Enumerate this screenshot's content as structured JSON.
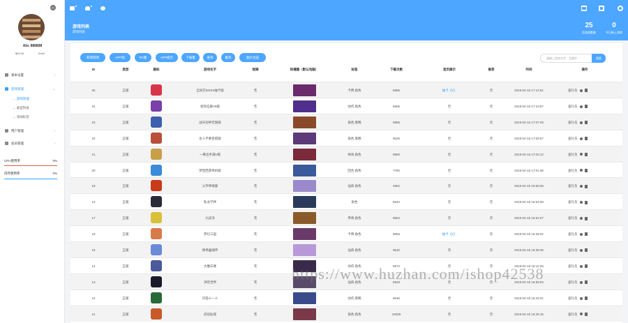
{
  "user": {
    "name": "Abc 888888",
    "balance_a": "$00.00",
    "balance_b": "Exx0"
  },
  "sidebar": {
    "items": [
      {
        "label": "基本设置"
      },
      {
        "label": "游戏管理"
      },
      {
        "label": "用户管理"
      },
      {
        "label": "会员管理"
      }
    ],
    "subitems": [
      {
        "label": "→ 游戏管理"
      },
      {
        "label": "→ 类型列表"
      },
      {
        "label": "→ 添加标签"
      }
    ],
    "stats": [
      {
        "label": "CPU使用率",
        "value": "0%"
      },
      {
        "label": "内存使用率",
        "value": "0%"
      }
    ]
  },
  "banner": {
    "title": "游戏列表",
    "subtitle": "游戏列表",
    "counters": [
      {
        "value": "25",
        "label": "总游戏数量"
      },
      {
        "value": "0",
        "label": "今日新上游戏"
      }
    ]
  },
  "toolbar": {
    "buttons": [
      "新增游戏",
      "APP图",
      "PC图",
      "APP提示",
      "下载量",
      "查询",
      "推荐",
      "图片合成"
    ],
    "search_placeholder": "请输入游戏名字、关键字",
    "search_label": "搜索"
  },
  "table": {
    "columns": [
      "ID",
      "类型",
      "图标",
      "游戏名字",
      "视频",
      "轮播图（默认电脑）",
      "标签",
      "下载次数",
      "首页展示",
      "推荐",
      "时间",
      "操作"
    ],
    "rows": [
      {
        "id": "25",
        "type": "正版",
        "name": "全民打BOSS抽卡版",
        "video": "无",
        "tags": "卡牌,角色",
        "downloads": "6895",
        "home": "抽卡【1】",
        "rec": "否",
        "time": "2019-02-15 17:14:01",
        "color": "#d8344a",
        "thumb": "#6a2a6c"
      },
      {
        "id": "24",
        "type": "正版",
        "name": "星际征服V8版",
        "video": "无",
        "tags": "动作,角色",
        "downloads": "6956",
        "home": "否",
        "rec": "否",
        "time": "2019-02-15 17:10:57",
        "color": "#7a3fa8",
        "thumb": "#502e8c"
      },
      {
        "id": "23",
        "type": "正版",
        "name": "战天封神无限版",
        "video": "无",
        "tags": "角色,策略",
        "downloads": "9856",
        "home": "否",
        "rec": "否",
        "time": "2019-02-15 17:07:49",
        "color": "#3d5fae",
        "thumb": "#8a4a2a"
      },
      {
        "id": "22",
        "type": "正版",
        "name": "女人不要百搭版",
        "video": "无",
        "tags": "角色,策略",
        "downloads": "9625",
        "home": "否",
        "rec": "否",
        "time": "2019-02-15 17:05:57",
        "color": "#b8503a",
        "thumb": "#5c3a7a"
      },
      {
        "id": "21",
        "type": "正版",
        "name": "一拳出手满V版",
        "video": "无",
        "tags": "休闲,角色",
        "downloads": "9850",
        "home": "否",
        "rec": "否",
        "time": "2019-02-15 17:03:12",
        "color": "#c8a04a",
        "thumb": "#7a2a3a"
      },
      {
        "id": "20",
        "type": "正版",
        "name": "梦回西游单机版",
        "video": "无",
        "tags": "回合,角色",
        "downloads": "7780",
        "home": "否",
        "rec": "否",
        "time": "2019-02-15 17:01:38",
        "color": "#3c8ad8",
        "thumb": "#3a5a9a"
      },
      {
        "id": "19",
        "type": "正版",
        "name": "斗罗神域版",
        "video": "无",
        "tags": "仙侠,角色",
        "downloads": "4852",
        "home": "否",
        "rec": "否",
        "time": "2019-02-15 16:59:35",
        "color": "#c83a1a",
        "thumb": "#9a8acc"
      },
      {
        "id": "14",
        "type": "正版",
        "name": "私龙学神",
        "video": "无",
        "tags": "角色",
        "downloads": "8542",
        "home": "否",
        "rec": "否",
        "time": "2019-02-15 16:53:38",
        "color": "#2a2a3a",
        "thumb": "#2a3a5a"
      },
      {
        "id": "17",
        "type": "正版",
        "name": "九段决",
        "video": "无",
        "tags": "传奇,角色",
        "downloads": "9562",
        "home": "否",
        "rec": "否",
        "time": "2019-02-15 16:51:07",
        "color": "#d8c03a",
        "thumb": "#8a5a2a"
      },
      {
        "id": "16",
        "type": "正版",
        "name": "梦幻三国",
        "video": "无",
        "tags": "卡牌,角色",
        "downloads": "9856",
        "home": "抽卡【1】",
        "rec": "否",
        "time": "2019-02-15 16:48:02",
        "color": "#d87a4a",
        "thumb": "#6a3a6a"
      },
      {
        "id": "15",
        "type": "正版",
        "name": "倩男幽魂传",
        "video": "无",
        "tags": "仙侠,角色",
        "downloads": "9632",
        "home": "否",
        "rec": "否",
        "time": "2019-02-15 16:39:39",
        "color": "#6a8ad8",
        "thumb": "#b89ad8"
      },
      {
        "id": "14",
        "type": "正版",
        "name": "大魔天尊",
        "video": "无",
        "tags": "动作,角色",
        "downloads": "8972",
        "home": "否",
        "rec": "否",
        "time": "2019-02-15 16:12:26",
        "color": "#4a5a9a",
        "thumb": "#3a2a4a"
      },
      {
        "id": "13",
        "type": "正版",
        "name": "洪荒世界",
        "video": "无",
        "tags": "仙侠,角色",
        "downloads": "8529",
        "home": "否",
        "rec": "否",
        "time": "2019-02-15 15:55:04",
        "color": "#1a1a2a",
        "thumb": "#5a4a6a"
      },
      {
        "id": "12",
        "type": "正版",
        "name": "闪电十一人",
        "video": "无",
        "tags": "动作,策略",
        "downloads": "8546",
        "home": "否",
        "rec": "否",
        "time": "2019-02-15 15:43:21",
        "color": "#2a6a3a",
        "thumb": "#3a4a8a"
      },
      {
        "id": "11",
        "type": "正版",
        "name": "武炫仙域",
        "video": "无",
        "tags": "角色,角色",
        "downloads": "15028",
        "home": "否",
        "rec": "否",
        "time": "2019-02-15 15:28:15",
        "color": "#c85a2a",
        "thumb": "#7a3a4a"
      }
    ],
    "action_label": "查礼包"
  },
  "watermark": "https://www.huzhan.com/ishop42538"
}
